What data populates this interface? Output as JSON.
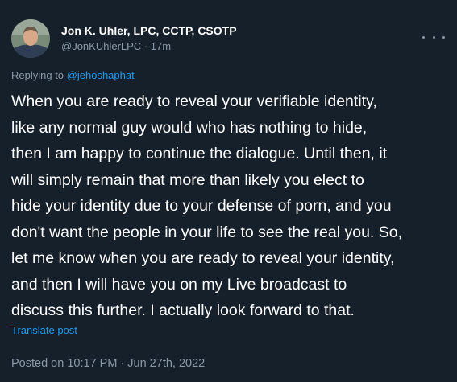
{
  "author": {
    "name": "Jon K. Uhler, LPC, CCTP, CSOTP",
    "handle": "@JonKUhlerLPC",
    "separator": "·",
    "time_ago": "17m"
  },
  "reply": {
    "prefix": "Replying to",
    "mention": "@jehoshaphat"
  },
  "body_lines": [
    "When you are ready to reveal your verifiable identity,",
    "like any normal guy would who has nothing to hide,",
    "then I am happy to continue the dialogue. Until then, it",
    "will simply remain that more than likely you elect to",
    "hide your identity due to your defense of porn, and you",
    "don't want the people in your life to see the real you. So,",
    "let me know when you are ready to reveal your identity,",
    "and then I will have you on my Live broadcast to",
    "discuss this further. I actually look forward to that."
  ],
  "translate_label": "Translate post",
  "posted": "Posted on 10:17 PM · Jun 27th, 2022",
  "icons": {
    "more": "more-horizontal-icon",
    "avatar": "avatar"
  },
  "colors": {
    "background": "#15202b",
    "text": "#ffffff",
    "secondary": "#8b98a5",
    "link": "#1d9bf0"
  }
}
